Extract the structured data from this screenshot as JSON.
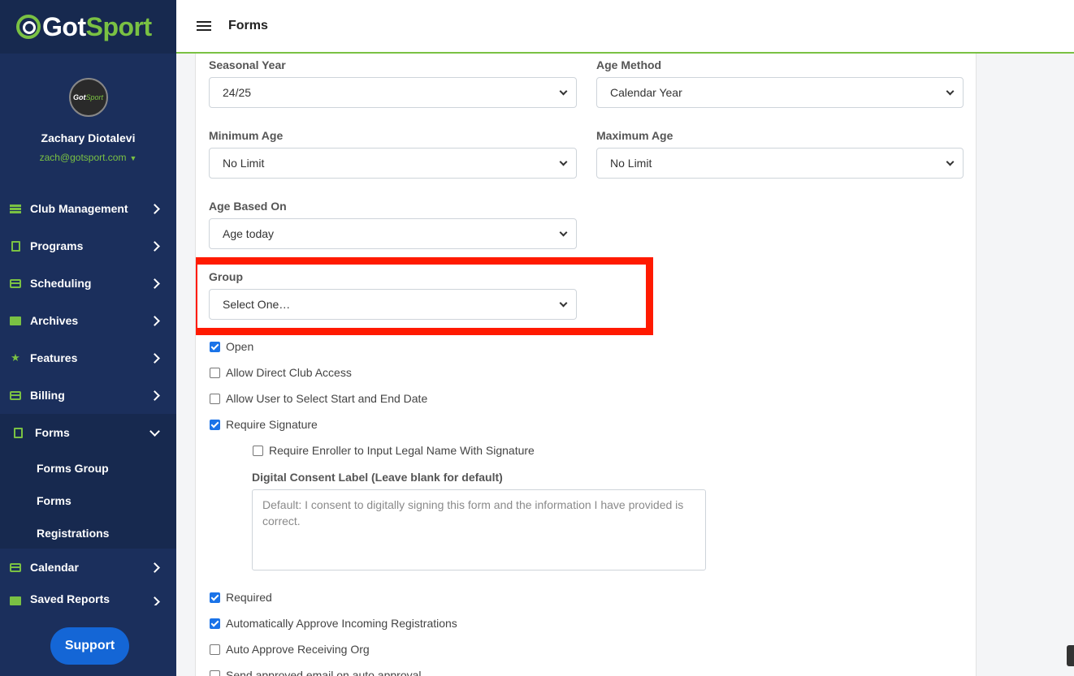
{
  "brand": {
    "got": "Got",
    "sport": "Sport"
  },
  "profile": {
    "avatar_text_got": "Got",
    "avatar_text_sport": "Sport",
    "name": "Zachary Diotalevi",
    "email": "zach@gotsport.com"
  },
  "sidebar": {
    "items": [
      {
        "label": "Club Management",
        "icon": "server-icon"
      },
      {
        "label": "Programs",
        "icon": "document-icon"
      },
      {
        "label": "Scheduling",
        "icon": "list-icon"
      },
      {
        "label": "Archives",
        "icon": "archive-icon"
      },
      {
        "label": "Features",
        "icon": "star-icon"
      },
      {
        "label": "Billing",
        "icon": "credit-card-icon"
      },
      {
        "label": "Forms",
        "icon": "file-icon"
      },
      {
        "label": "Calendar",
        "icon": "calendar-icon"
      },
      {
        "label": "Saved Reports",
        "icon": "report-icon"
      }
    ],
    "forms_sub": [
      "Forms Group",
      "Forms",
      "Registrations"
    ],
    "support": "Support"
  },
  "topbar": {
    "title": "Forms"
  },
  "form": {
    "seasonal_year": {
      "label": "Seasonal Year",
      "value": "24/25"
    },
    "age_method": {
      "label": "Age Method",
      "value": "Calendar Year"
    },
    "minimum_age": {
      "label": "Minimum Age",
      "value": "No Limit"
    },
    "maximum_age": {
      "label": "Maximum Age",
      "value": "No Limit"
    },
    "age_based_on": {
      "label": "Age Based On",
      "value": "Age today"
    },
    "group": {
      "label": "Group",
      "value": "Select One…"
    },
    "checks": [
      {
        "label": "Open",
        "checked": true
      },
      {
        "label": "Allow Direct Club Access",
        "checked": false
      },
      {
        "label": "Allow User to Select Start and End Date",
        "checked": false
      },
      {
        "label": "Require Signature",
        "checked": true
      },
      {
        "label": "Require Enroller to Input Legal Name With Signature",
        "checked": false
      },
      {
        "label": "Required",
        "checked": true
      },
      {
        "label": "Automatically Approve Incoming Registrations",
        "checked": true
      },
      {
        "label": "Auto Approve Receiving Org",
        "checked": false
      },
      {
        "label": "Send approved email on auto approval",
        "checked": false
      }
    ],
    "digital_consent": {
      "label": "Digital Consent Label (Leave blank for default)",
      "placeholder": "Default: I consent to digitally signing this form and the information I have provided is correct."
    }
  }
}
